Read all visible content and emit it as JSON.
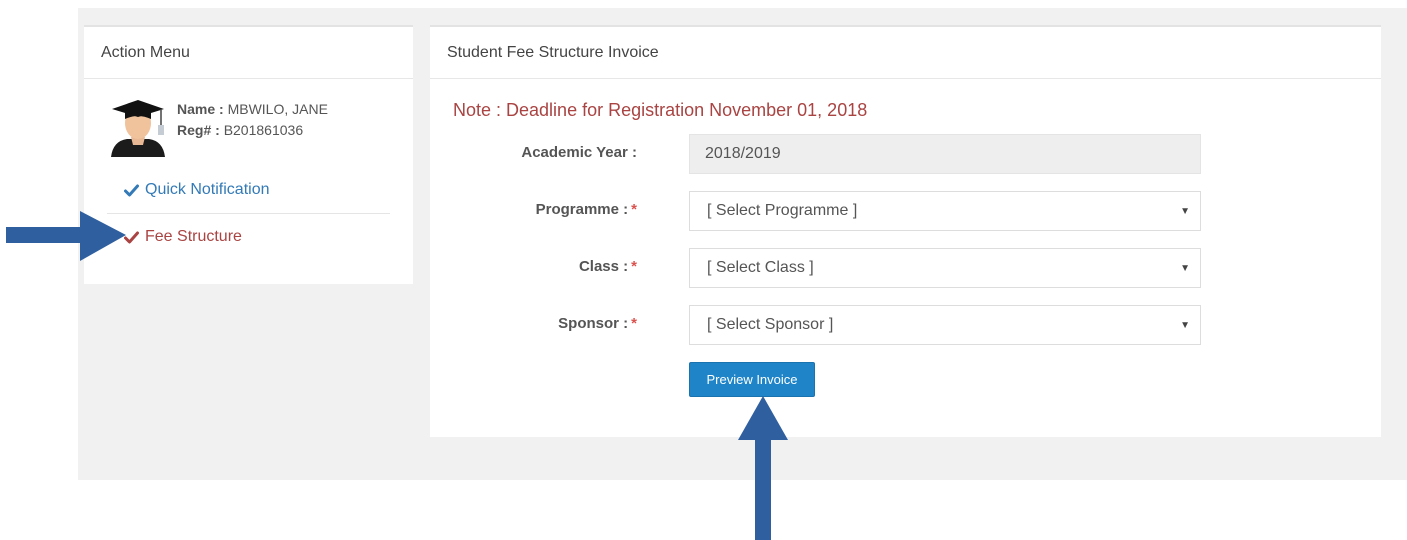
{
  "action_menu": {
    "title": "Action Menu",
    "profile": {
      "name_label": "Name :",
      "name_value": "MBWILO, JANE",
      "reg_label": "Reg# :",
      "reg_value": "B201861036"
    },
    "items": [
      {
        "label": "Quick Notification",
        "icon": "check-icon",
        "color": "#337ab7"
      },
      {
        "label": "Fee Structure",
        "icon": "check-icon",
        "color": "#a94442"
      }
    ]
  },
  "invoice_panel": {
    "title": "Student Fee Structure Invoice",
    "note": "Note : Deadline for Registration November 01, 2018",
    "academic_year": {
      "label": "Academic Year :",
      "value": "2018/2019"
    },
    "programme": {
      "label": "Programme :",
      "required": "*",
      "value": "[ Select Programme ]"
    },
    "class": {
      "label": "Class :",
      "required": "*",
      "value": "[ Select Class ]"
    },
    "sponsor": {
      "label": "Sponsor :",
      "required": "*",
      "value": "[ Select Sponsor ]"
    },
    "preview_button": "Preview Invoice"
  },
  "colors": {
    "accent": "#1f85c8",
    "link": "#337ab7",
    "danger": "#a94442",
    "annotation_arrow": "#2f5f9e"
  }
}
